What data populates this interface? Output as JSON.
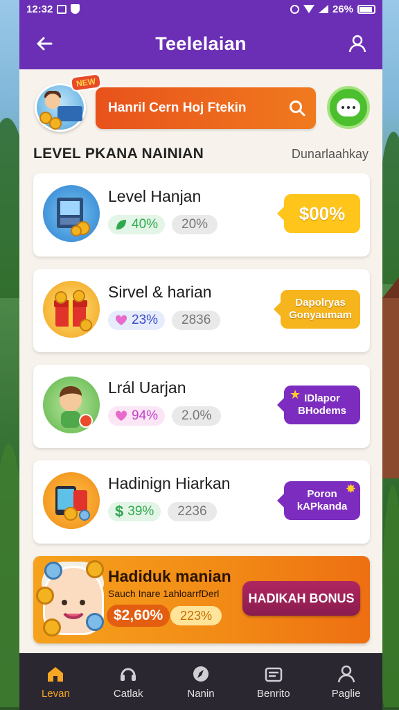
{
  "status_bar": {
    "time": "12:32",
    "battery": "26%"
  },
  "header": {
    "title": "Teelelaian",
    "back_icon": "arrow-left-icon",
    "profile_icon": "user-icon"
  },
  "search": {
    "badge": "NEW",
    "text": "Hanril Cern Hoj Ftekin",
    "search_icon": "search-icon",
    "chat_icon": "chat-bubble-icon"
  },
  "section": {
    "title": "LEVEL PKANA  NAINIAN",
    "link": "Dunarlaahkay"
  },
  "cards": [
    {
      "title": "Level Hanjan",
      "pct": "40%",
      "secondary": "20%",
      "reward": "$00%",
      "icon": "computer-coins-icon",
      "accent": "#2fa84f"
    },
    {
      "title": "Sirvel & harian",
      "pct": "23%",
      "secondary": "2836",
      "reward_line1": "Dapolryas",
      "reward_line2": "Gonyaumam",
      "icon": "gift-box-icon",
      "accent": "#3b4fc9"
    },
    {
      "title": "Lrál Uarjan",
      "pct": "94%",
      "secondary": "2.0%",
      "reward_line1": "IDlapor",
      "reward_line2": "BHodems",
      "icon": "kid-character-icon",
      "accent": "#c23ec9"
    },
    {
      "title": "Hadinign Hiarkan",
      "pct": "39%",
      "secondary": "2236",
      "reward_line1": "Poron",
      "reward_line2": "kAPkanda",
      "icon": "phone-coins-icon",
      "accent": "#2fa84f"
    }
  ],
  "promo": {
    "title": "Hadiduk manian",
    "subtitle": "Sauch Inare   1ahloarrfDerl",
    "price": "$2,60%",
    "pill": "223%",
    "button": "HADIKAH BONUS"
  },
  "nav": [
    {
      "label": "Levan",
      "icon": "home-icon",
      "active": true
    },
    {
      "label": "Catlak",
      "icon": "headset-icon",
      "active": false
    },
    {
      "label": "Nanin",
      "icon": "compass-icon",
      "active": false
    },
    {
      "label": "Benrito",
      "icon": "wallet-icon",
      "active": false
    },
    {
      "label": "Paglie",
      "icon": "user-icon",
      "active": false
    }
  ],
  "colors": {
    "brand": "#6a2fb5",
    "search": "#e8521c",
    "chat": "#4cbf2f",
    "reward_yellow": "#ffc51a",
    "reward_purple": "#7c2dbf",
    "active_nav": "#f5a623"
  }
}
